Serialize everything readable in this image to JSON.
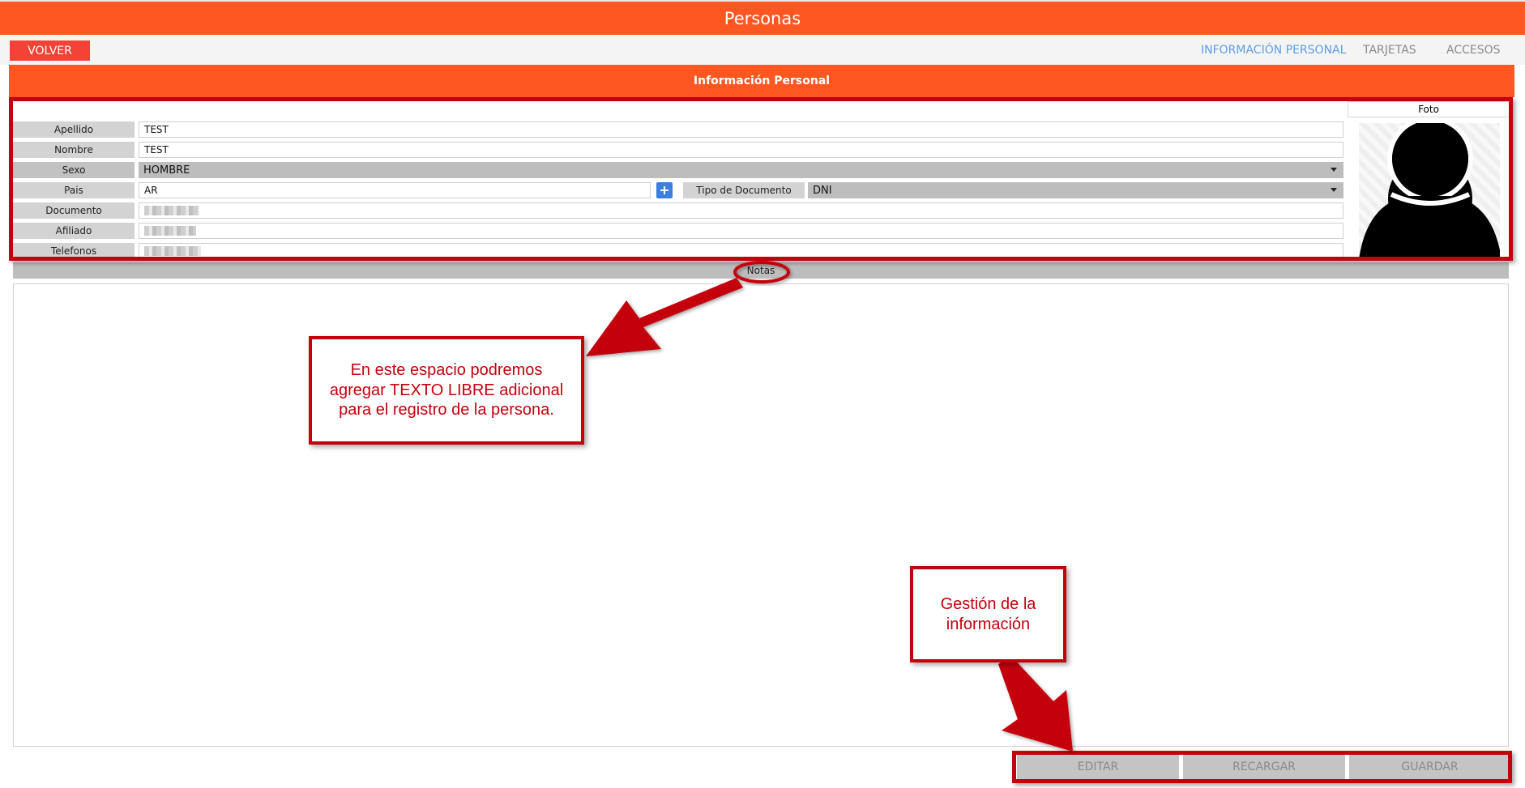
{
  "window": {
    "title": "Personas"
  },
  "toolbar": {
    "back_label": "VOLVER",
    "tabs": [
      {
        "label": "INFORMACIÓN PERSONAL",
        "active": true
      },
      {
        "label": "TARJETAS",
        "active": false
      },
      {
        "label": "ACCESOS",
        "active": false
      }
    ]
  },
  "section": {
    "title": "Información Personal"
  },
  "form": {
    "apellido": {
      "label": "Apellido",
      "value": "TEST"
    },
    "nombre": {
      "label": "Nombre",
      "value": "TEST"
    },
    "sexo": {
      "label": "Sexo",
      "value": "HOMBRE"
    },
    "pais": {
      "label": "Pais",
      "value": "AR"
    },
    "tipo_documento": {
      "label": "Tipo de Documento",
      "value": "DNI"
    },
    "documento": {
      "label": "Documento"
    },
    "afiliado": {
      "label": "Afiliado"
    },
    "telefonos": {
      "label": "Telefonos"
    }
  },
  "photo": {
    "label": "Foto"
  },
  "notes": {
    "label": "Notas"
  },
  "actions": {
    "edit": "EDITAR",
    "reload": "RECARGAR",
    "save": "GUARDAR"
  },
  "annotations": {
    "notes_callout_lines": [
      "En este espacio podremos",
      "agregar TEXTO LIBRE adicional",
      "para el registro de la persona."
    ],
    "actions_callout_lines": [
      "Gestión de la",
      "información"
    ]
  },
  "colors": {
    "accent": "#FF5722",
    "back_button": "#F44336",
    "active_tab": "#5c9de6",
    "annotation": "#c4000d",
    "add_button": "#3b7fe0"
  },
  "icons": {
    "add": "plus-icon",
    "photo_placeholder": "user-silhouette-icon",
    "dropdown": "chevron-down-icon"
  }
}
